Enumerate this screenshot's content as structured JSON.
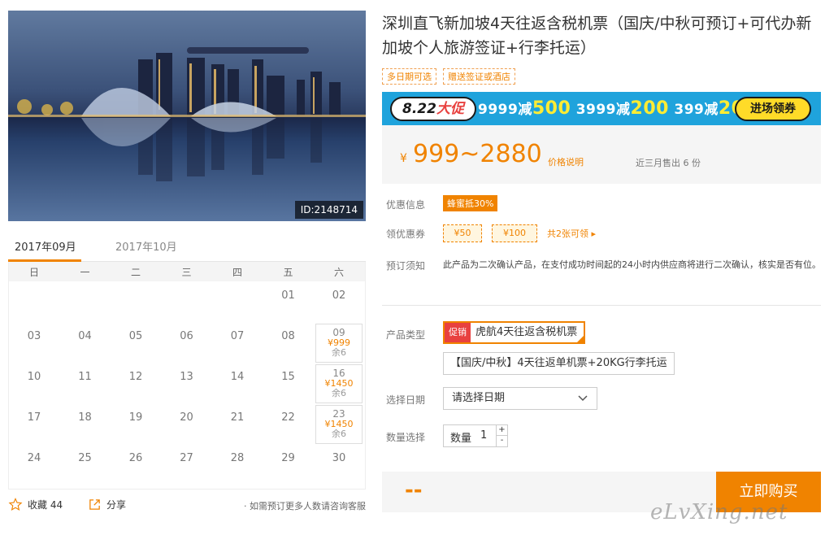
{
  "photo": {
    "id_label": "ID:2148714"
  },
  "calendar": {
    "tabs": [
      "2017年09月",
      "2017年10月"
    ],
    "weekdays": [
      "日",
      "一",
      "二",
      "三",
      "四",
      "五",
      "六"
    ],
    "weeks": [
      [
        {
          "d": ""
        },
        {
          "d": ""
        },
        {
          "d": ""
        },
        {
          "d": ""
        },
        {
          "d": ""
        },
        {
          "d": "01"
        },
        {
          "d": "02"
        }
      ],
      [
        {
          "d": "03"
        },
        {
          "d": "04"
        },
        {
          "d": "05"
        },
        {
          "d": "06"
        },
        {
          "d": "07"
        },
        {
          "d": "08"
        },
        {
          "d": "09",
          "price": "¥999",
          "stock": "余6"
        }
      ],
      [
        {
          "d": "10"
        },
        {
          "d": "11"
        },
        {
          "d": "12"
        },
        {
          "d": "13"
        },
        {
          "d": "14"
        },
        {
          "d": "15"
        },
        {
          "d": "16",
          "price": "¥1450",
          "stock": "余6"
        }
      ],
      [
        {
          "d": "17"
        },
        {
          "d": "18"
        },
        {
          "d": "19"
        },
        {
          "d": "20"
        },
        {
          "d": "21"
        },
        {
          "d": "22"
        },
        {
          "d": "23",
          "price": "¥1450",
          "stock": "余6"
        }
      ],
      [
        {
          "d": "24"
        },
        {
          "d": "25"
        },
        {
          "d": "26"
        },
        {
          "d": "27"
        },
        {
          "d": "28"
        },
        {
          "d": "29"
        },
        {
          "d": "30"
        }
      ]
    ]
  },
  "actions": {
    "favorite": "收藏 44",
    "share": "分享",
    "consult": "· 如需预订更多人数请咨询客服"
  },
  "product": {
    "title": "深圳直飞新加坡4天往返含税机票（国庆/中秋可预订+可代办新加坡个人旅游签证+行李托运）",
    "tags": [
      "多日期可选",
      "赠送签证或酒店"
    ]
  },
  "promo_banner": {
    "badge_num": "8.22",
    "badge_text": "大促",
    "offers": [
      {
        "threshold": "9999减",
        "amount": "500"
      },
      {
        "threshold": "3999减",
        "amount": "200"
      },
      {
        "threshold": "399减",
        "amount": "20"
      }
    ],
    "button": "进场领券"
  },
  "price": {
    "currency": "¥",
    "range": "999~2880",
    "note": "价格说明",
    "sold": "近三月售出 6 份"
  },
  "labels": {
    "discount": "优惠信息",
    "coupon": "领优惠券",
    "notice": "预订须知",
    "product_type": "产品类型",
    "date": "选择日期",
    "quantity": "数量选择"
  },
  "discount_badge": "蜂蜜抵30%",
  "coupons": [
    "¥50",
    "¥100"
  ],
  "coupon_more": "共2张可领 ▸",
  "notice_text": "此产品为二次确认产品，在支付成功时间起的24小时内供应商将进行二次确认，核实是否有位。",
  "product_types": [
    {
      "tag": "促销",
      "label": "虎航4天往返含税机票"
    },
    {
      "label": "【国庆/中秋】4天往返单机票+20KG行李托运"
    }
  ],
  "date_select": {
    "placeholder": "请选择日期"
  },
  "quantity": {
    "label": "数量",
    "value": "1",
    "plus": "+",
    "minus": "-"
  },
  "buy": {
    "total": "--",
    "button": "立即购买"
  },
  "watermark": "eLvXing.net",
  "colors": {
    "accent": "#f08300",
    "promo_blue": "#1fa3dc",
    "promo_red": "#e8413f"
  }
}
